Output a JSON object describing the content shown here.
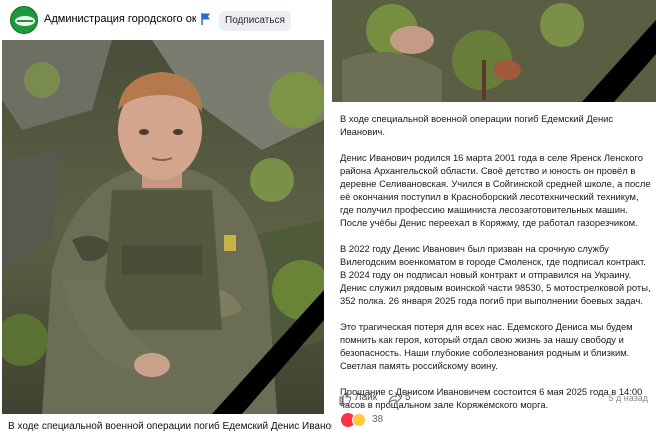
{
  "left_post": {
    "group_name": "Администрация городского округа \"Г...",
    "subscribe_label": "Подписаться",
    "caption": "В ходе специальной военной операции погиб Едемский Денис Иванович."
  },
  "right_post": {
    "paragraphs": [
      "В ходе специальной военной операции погиб Едемский Денис Иванович.",
      "Денис Иванович родился 16 марта 2001 года в селе Яренск Ленского района Архангельской области. Своё детство и юность он провёл в деревне Селивановская. Учился в Сойгинской средней школе, а после её окончания поступил в Красноборский лесотехнический техникум, где получил профессию машиниста лесозаготовительных машин. После учёбы Денис переехал в Коряжму, где работал газорезчиком.",
      "В 2022 году Денис Иванович был призван на срочную службу Вилегодским военкоматом в городе Смоленск, где подписал контракт. В 2024 году он подписал новый контракт и отправился на Украину. Денис служил рядовым воинской части 98530, 5 мотострелковой роты, 352 полка. 26 января 2025 года погиб при выполнении боевых задач.",
      "Это трагическая потеря для всех нас. Едемского Дениса мы будем помнить как героя, который отдал свою жизнь за нашу свободу и безопасность. Наши глубокие соболезнования родным и близким. Светлая память российскому воину.",
      "Прощание с Денисом Ивановичем состоится 6 мая 2025 года в 14:00 часов в прощальном зале Коряжемского морга."
    ],
    "actions": {
      "like_label": "Лайк",
      "share_count": "5",
      "time_ago": "5 д назад",
      "reaction_count": "38"
    }
  },
  "colors": {
    "heart": "#ff3347",
    "sad": "#ffc83d",
    "mourning_ribbon": "#000000",
    "subscribe_bg": "#eceef1",
    "avatar_green": "#1e9a3a"
  },
  "icons": [
    "flag-icon",
    "like-icon",
    "share-icon",
    "heart-reaction-icon",
    "sad-reaction-icon",
    "mourning-ribbon"
  ]
}
